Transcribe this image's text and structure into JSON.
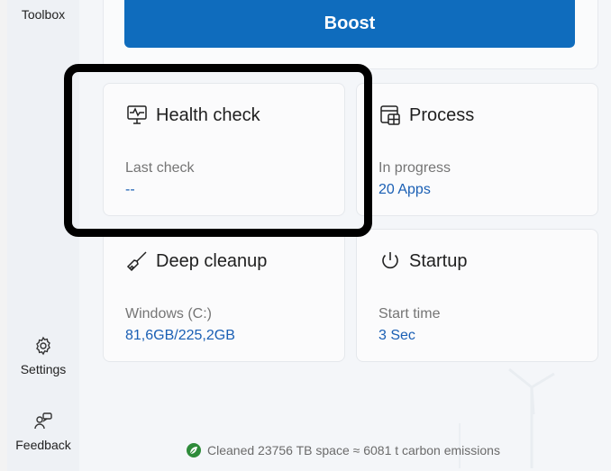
{
  "sidebar": {
    "toolbox_label": "Toolbox",
    "settings_label": "Settings",
    "feedback_label": "Feedback"
  },
  "boost": {
    "label": "Boost"
  },
  "cards": {
    "health": {
      "title": "Health check",
      "sub": "Last check",
      "value": "--",
      "icon": "monitor-pulse-icon"
    },
    "process": {
      "title": "Process",
      "sub": "In progress",
      "value": "20 Apps",
      "icon": "window-apps-icon"
    },
    "cleanup": {
      "title": "Deep cleanup",
      "sub": "Windows (C:)",
      "value": "81,6GB/225,2GB",
      "icon": "broom-icon"
    },
    "startup": {
      "title": "Startup",
      "sub": "Start time",
      "value": "3 Sec",
      "icon": "power-icon"
    }
  },
  "footer": {
    "text": "Cleaned 23756 TB space ≈ 6081 t carbon emissions",
    "icon": "eco-leaf-icon"
  },
  "colors": {
    "accent": "#0f6cbd",
    "link": "#1a5fb4",
    "highlight": "#000000"
  }
}
